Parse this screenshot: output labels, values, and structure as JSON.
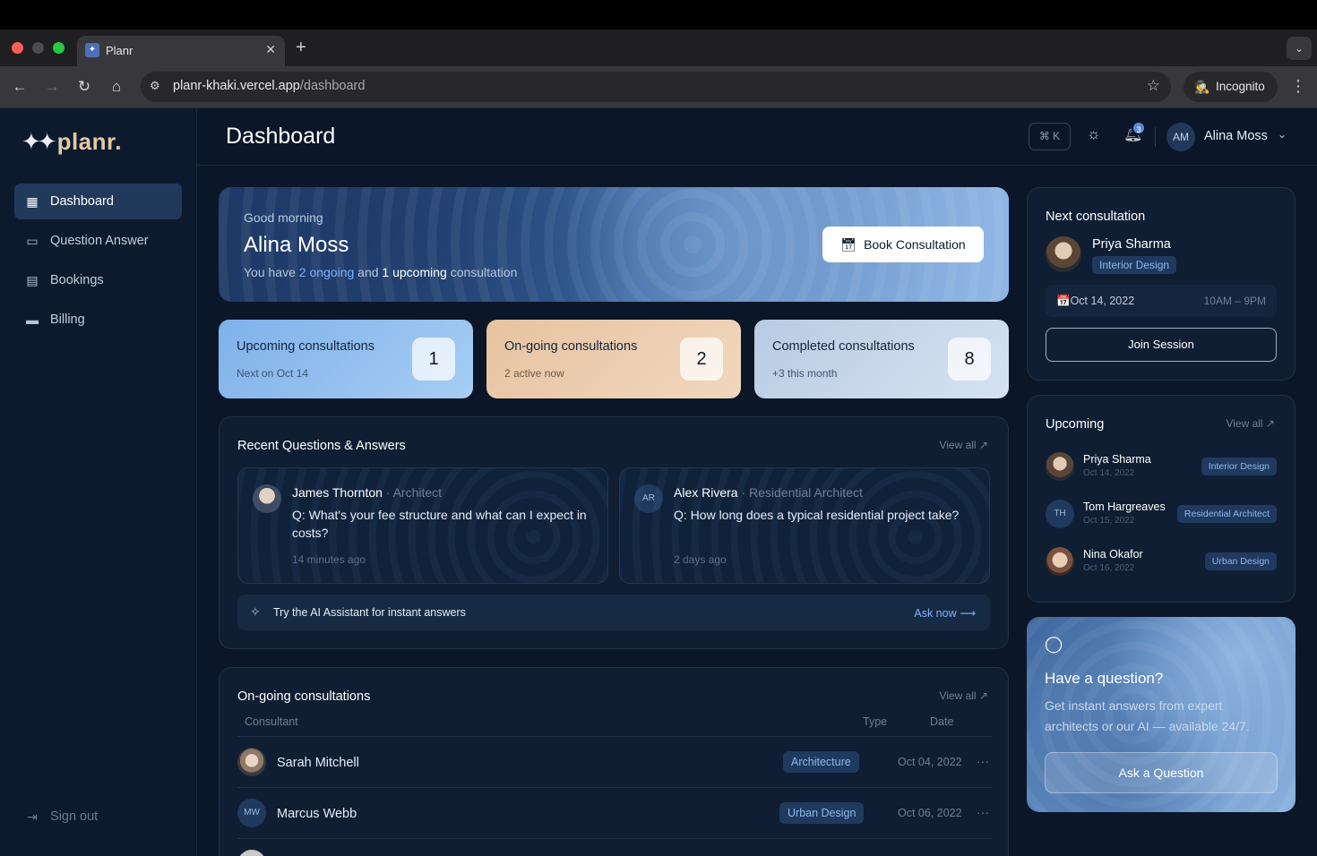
{
  "browser": {
    "tab_title": "Planr",
    "url_host": "planr-khaki.vercel.app",
    "url_path": "/dashboard",
    "incognito_label": "Incognito"
  },
  "sidebar": {
    "logo_text": "planr",
    "logo_dot": ".",
    "items": [
      {
        "label": "Dashboard",
        "icon": "grid-icon",
        "active": true
      },
      {
        "label": "Question Answer",
        "icon": "message-square-icon",
        "active": false
      },
      {
        "label": "Bookings",
        "icon": "calendar-icon",
        "active": false
      },
      {
        "label": "Billing",
        "icon": "credit-card-icon",
        "active": false
      }
    ],
    "signout_label": "Sign out"
  },
  "header": {
    "title": "Dashboard",
    "shortcut": "⌘ K",
    "notification_count": "3",
    "user_initials": "AM",
    "user_name": "Alina Moss"
  },
  "hero": {
    "greeting": "Good morning",
    "name": "Alina Moss",
    "sub_prefix": "You have ",
    "ongoing": "2 ongoing",
    "sub_mid": " and ",
    "upcoming": "1 upcoming",
    "sub_suffix": " consultation",
    "book_label": "Book Consultation"
  },
  "stats": [
    {
      "title": "Upcoming consultations",
      "sub": "Next on Oct 14",
      "value": "1"
    },
    {
      "title": "On-going consultations",
      "sub": "2 active now",
      "value": "2"
    },
    {
      "title": "Completed consultations",
      "sub": "+3 this month",
      "value": "8"
    }
  ],
  "qa": {
    "title": "Recent Questions & Answers",
    "view_all": "View all ↗",
    "items": [
      {
        "name": "James Thornton",
        "role": " · Architect",
        "question": "Q: What's your fee structure and what can I expect in costs?",
        "time": "14 minutes ago",
        "initials": ""
      },
      {
        "name": "Alex Rivera",
        "role": " · Residential Architect",
        "question": "Q: How long does a typical residential project take?",
        "time": "2 days ago",
        "initials": "AR"
      }
    ],
    "ai_text": "Try the AI Assistant for instant answers",
    "ai_link": "Ask now ⟶"
  },
  "ongoing": {
    "title": "On-going consultations",
    "view_all": "View all ↗",
    "col_consultant": "Consultant",
    "col_type": "Type",
    "col_date": "Date",
    "rows": [
      {
        "name": "Sarah Mitchell",
        "type": "Architecture",
        "date": "Oct 04, 2022",
        "initials": ""
      },
      {
        "name": "Marcus Webb",
        "type": "Urban Design",
        "date": "Oct 06, 2022",
        "initials": "MW"
      }
    ]
  },
  "next_consultation": {
    "title": "Next consultation",
    "name": "Priya Sharma",
    "type": "Interior Design",
    "date": "📅Oct 14, 2022",
    "time": "10AM – 9PM",
    "join_label": "Join Session"
  },
  "upcoming": {
    "title": "Upcoming",
    "view_all": "View all ↗",
    "items": [
      {
        "name": "Priya Sharma",
        "date": "Oct 14, 2022",
        "type": "Interior Design",
        "initials": ""
      },
      {
        "name": "Tom Hargreaves",
        "date": "Oct 15, 2022",
        "type": "Residential Architect",
        "initials": "TH"
      },
      {
        "name": "Nina Okafor",
        "date": "Oct 16, 2022",
        "type": "Urban Design",
        "initials": ""
      }
    ]
  },
  "ask": {
    "title": "Have a question?",
    "sub": "Get instant answers from expert architects or our AI — available 24/7.",
    "button": "Ask a Question"
  }
}
